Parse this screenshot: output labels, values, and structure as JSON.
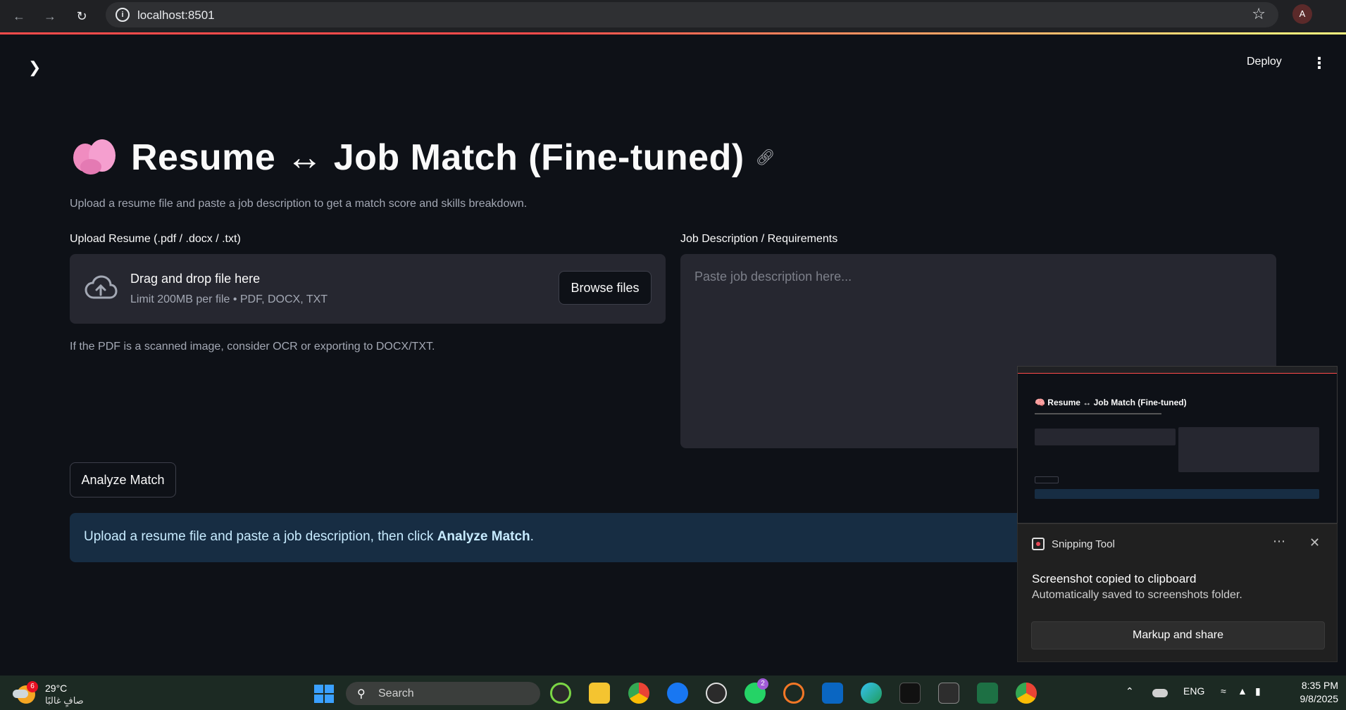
{
  "browser": {
    "url": "localhost:8501",
    "profile_initial": "A"
  },
  "toolbar": {
    "deploy_label": "Deploy"
  },
  "page": {
    "title": "Resume ↔ Job Match (Fine-tuned)",
    "subtitle": "Upload a resume file and paste a job description to get a match score and skills breakdown.",
    "upload_label": "Upload Resume (.pdf / .docx / .txt)",
    "drag_title": "Drag and drop file here",
    "drag_limit": "Limit 200MB per file • PDF, DOCX, TXT",
    "browse_label": "Browse files",
    "ocr_hint": "If the PDF is a scanned image, consider OCR or exporting to DOCX/TXT.",
    "jd_label": "Job Description / Requirements",
    "jd_placeholder": "Paste job description here...",
    "analyze_label": "Analyze Match",
    "info_prefix": "Upload a resume file and paste a job description, then click ",
    "info_bold": "Analyze Match",
    "info_suffix": "."
  },
  "snip_preview": {
    "title": "🧠 Resume ↔ Job Match (Fine-tuned)"
  },
  "toast": {
    "app_name": "Snipping Tool",
    "heading": "Screenshot copied to clipboard",
    "body": "Automatically saved to screenshots folder.",
    "button": "Markup and share"
  },
  "taskbar": {
    "weather_badge": "6",
    "temperature": "29°C",
    "condition": "صافٍ غالبًا",
    "search_label": "Search",
    "whatsapp_badge": "2",
    "language": "ENG",
    "time": "8:35 PM",
    "date": "9/8/2025"
  },
  "colors": {
    "background": "#0e1117",
    "input_bg": "#262730",
    "info_bg": "#172d43",
    "info_text": "#c7ebff",
    "accent": "#ff4b4b"
  }
}
